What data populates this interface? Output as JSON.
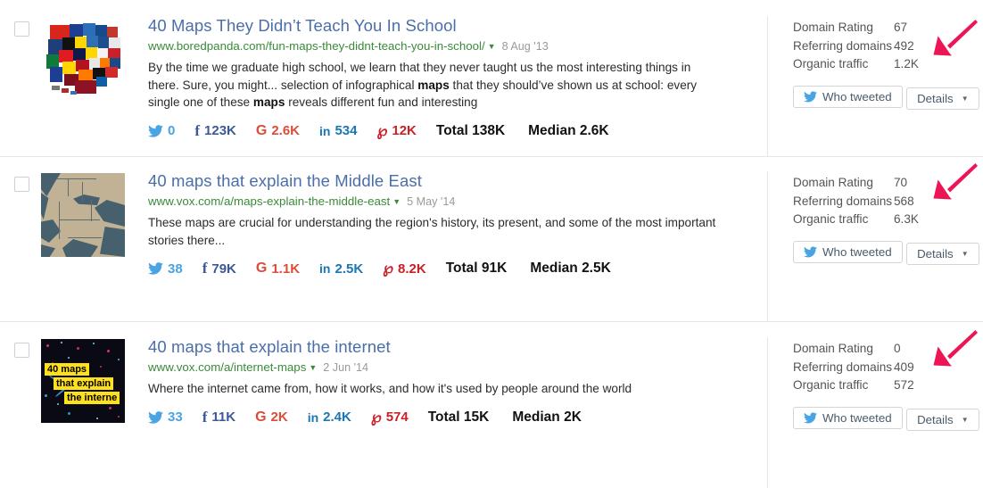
{
  "results": [
    {
      "title": "40 Maps They Didn’t Teach You In School",
      "url": "www.boredpanda.com/fun-maps-they-didnt-teach-you-in-school/",
      "date": "8 Aug '13",
      "desc_parts": {
        "p1": "By the time we graduate high school, we learn that they never taught us the most interesting things in there. Sure, you might... selection of infographical ",
        "b1": "maps",
        "p2": " that they should’ve shown us at school: every single one of these ",
        "b2": "maps",
        "p3": " reveals different fun and interesting"
      },
      "metrics": {
        "twitter": "0",
        "facebook": "123K",
        "googleplus": "2.6K",
        "linkedin": "534",
        "pinterest": "12K",
        "total_label": "Total",
        "total_value": "138K",
        "median_label": "Median",
        "median_value": "2.6K"
      },
      "stats": [
        {
          "label": "Domain Rating",
          "value": "67"
        },
        {
          "label": "Referring domains",
          "value": "492"
        },
        {
          "label": "Organic traffic",
          "value": "1.2K"
        }
      ],
      "who_tweeted_label": "Who tweeted",
      "details_label": "Details",
      "thumb_kind": "us-brand-map"
    },
    {
      "title": "40 maps that explain the Middle East",
      "url": "www.vox.com/a/maps-explain-the-middle-east",
      "date": "5 May '14",
      "desc_parts": {
        "p1": "These maps are crucial for understanding the region's history, its present, and some of the most important stories there...",
        "b1": "",
        "p2": "",
        "b2": "",
        "p3": ""
      },
      "metrics": {
        "twitter": "38",
        "facebook": "79K",
        "googleplus": "1.1K",
        "linkedin": "2.5K",
        "pinterest": "8.2K",
        "total_label": "Total",
        "total_value": "91K",
        "median_label": "Median",
        "median_value": "2.5K"
      },
      "stats": [
        {
          "label": "Domain Rating",
          "value": "70"
        },
        {
          "label": "Referring domains",
          "value": "568"
        },
        {
          "label": "Organic traffic",
          "value": "6.3K"
        }
      ],
      "who_tweeted_label": "Who tweeted",
      "details_label": "Details",
      "thumb_kind": "middle-east-map"
    },
    {
      "title": "40 maps that explain the internet",
      "url": "www.vox.com/a/internet-maps",
      "date": "2 Jun '14",
      "desc_parts": {
        "p1": "Where the internet came from, how it works, and how it's used by people around the world",
        "b1": "",
        "p2": "",
        "b2": "",
        "p3": ""
      },
      "metrics": {
        "twitter": "33",
        "facebook": "11K",
        "googleplus": "2K",
        "linkedin": "2.4K",
        "pinterest": "574",
        "total_label": "Total",
        "total_value": "15K",
        "median_label": "Median",
        "median_value": "2K"
      },
      "stats": [
        {
          "label": "Domain Rating",
          "value": "0"
        },
        {
          "label": "Referring domains",
          "value": "409"
        },
        {
          "label": "Organic traffic",
          "value": "572"
        }
      ],
      "who_tweeted_label": "Who tweeted",
      "details_label": "Details",
      "thumb_kind": "internet-maps-cover",
      "thumb_text": [
        "40 maps",
        "that explain",
        "the interne"
      ]
    }
  ],
  "annotations": {
    "arrow_color": "#ec1556",
    "arrow_count": 3,
    "arrow_points_to": "Referring domains"
  },
  "colors": {
    "title_link": "#4a6ea9",
    "url_green": "#3a8a3a",
    "date_gray": "#9a9a9a",
    "twitter": "#4aa3e3",
    "facebook": "#3b5998",
    "googleplus": "#dd4b39",
    "linkedin": "#1a77b5",
    "pinterest": "#cb2027",
    "divider": "#e6e6e6"
  }
}
